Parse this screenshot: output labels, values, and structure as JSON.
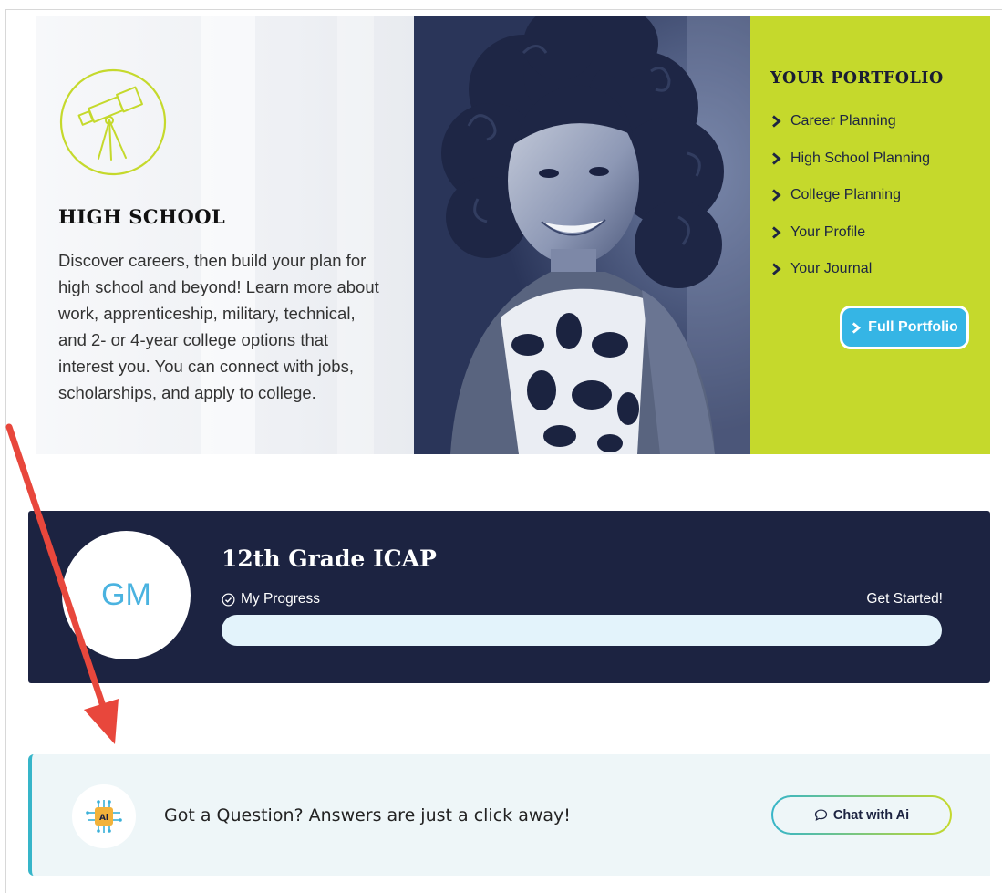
{
  "hero": {
    "title": "HIGH SCHOOL",
    "description": "Discover careers, then build your plan for high school and beyond! Learn more about work, apprenticeship, military, technical, and 2- or 4-year college options that interest you. You can connect with jobs, scholarships, and apply to college.",
    "icon": "telescope-icon"
  },
  "portfolio": {
    "title": "YOUR PORTFOLIO",
    "items": [
      {
        "label": "Career Planning"
      },
      {
        "label": "High School Planning"
      },
      {
        "label": "College Planning"
      },
      {
        "label": "Your Profile"
      },
      {
        "label": "Your Journal"
      }
    ],
    "button_label": "Full Portfolio"
  },
  "icap": {
    "avatar_initials": "GM",
    "title": "12th Grade ICAP",
    "progress_label": "My Progress",
    "progress_status": "Get Started!",
    "progress_fraction": 0
  },
  "ai": {
    "icon_label": "Ai",
    "question": "Got a Question? Answers are just a click away!",
    "chat_button_label": "Chat with Ai"
  },
  "colors": {
    "accent_lime": "#c5d92c",
    "navy": "#1c2341",
    "sky": "#35b5e5",
    "teal": "#36b5c9",
    "arrow_red": "#e8473c"
  }
}
